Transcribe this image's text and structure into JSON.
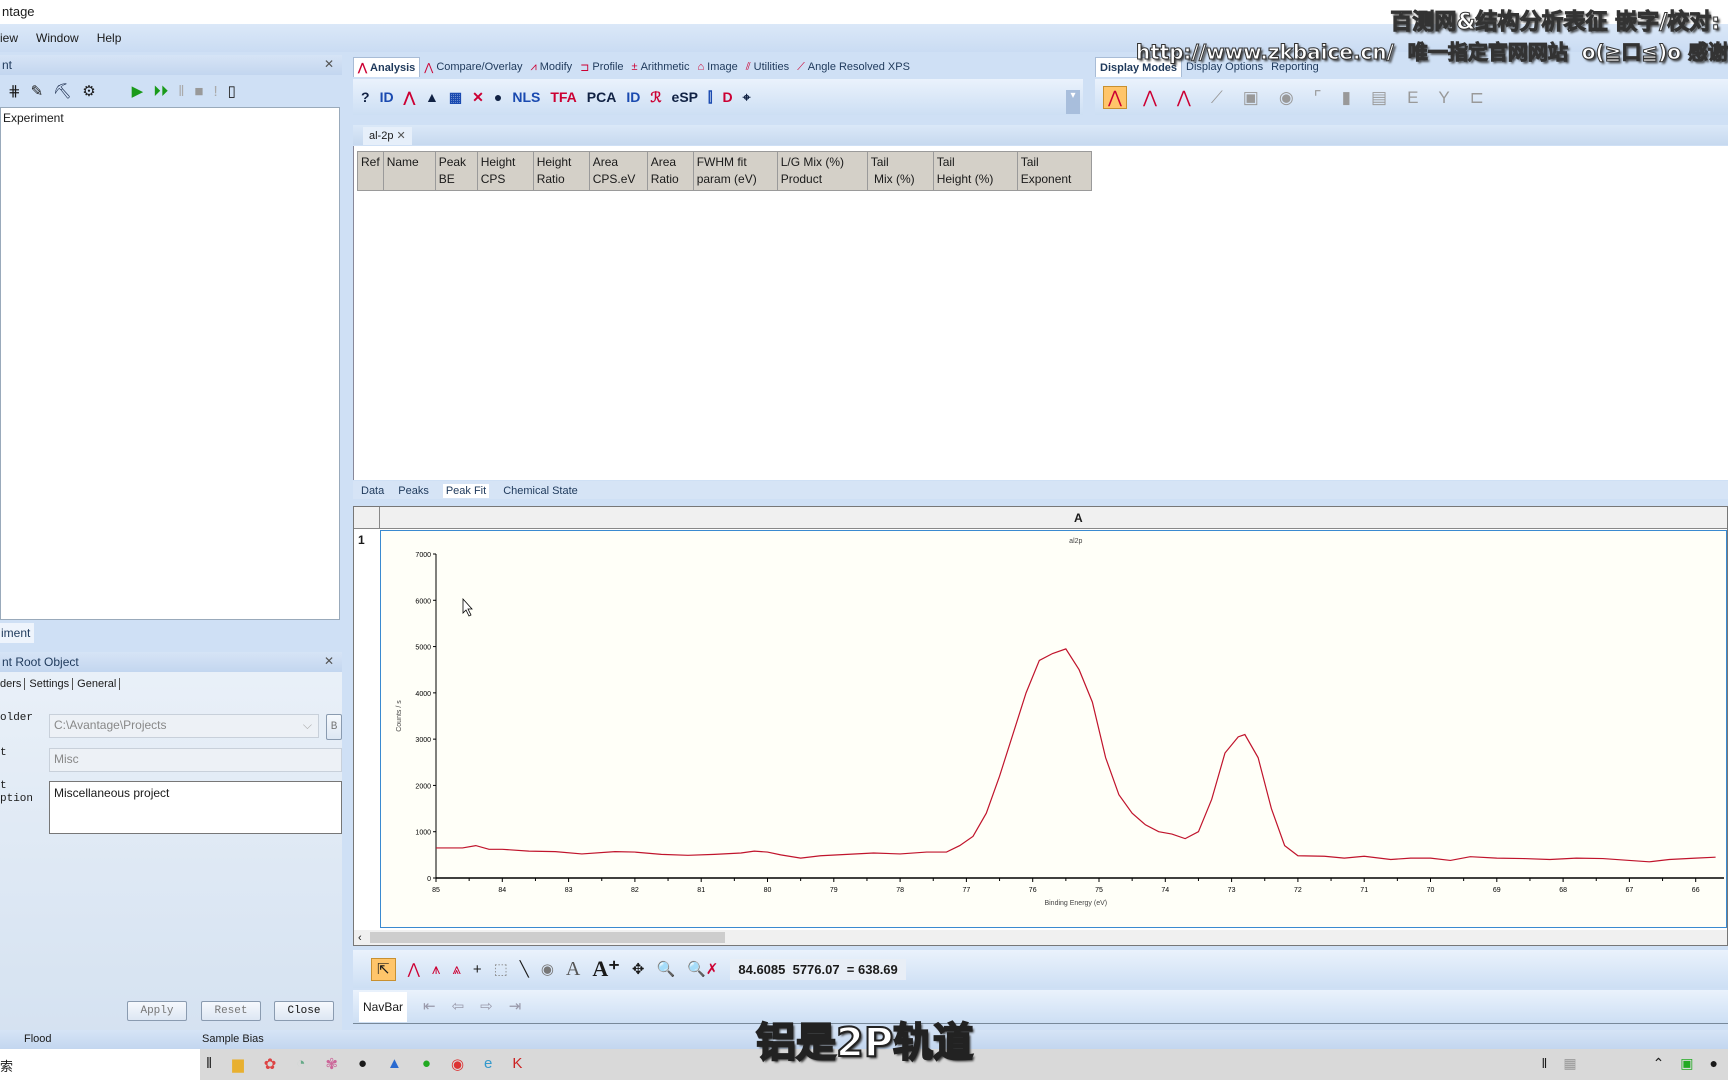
{
  "window": {
    "title": "ntage"
  },
  "menu": [
    "iew",
    "Window",
    "Help"
  ],
  "left_panel": {
    "title": "nt",
    "tree_item": "Experiment",
    "bottom_tab": "iment",
    "props_title": "nt Root Object",
    "tabs": [
      "ders",
      "Settings",
      "General"
    ],
    "fields": [
      {
        "label": "older",
        "value": "C:\\Avantage\\Projects",
        "button": "B"
      },
      {
        "label": "t",
        "value": "Misc"
      },
      {
        "label": "t\nption",
        "value": "Miscellaneous project"
      }
    ],
    "buttons": [
      "Apply",
      "Reset",
      "Close"
    ]
  },
  "ribbon": {
    "tabs": [
      "Analysis",
      "Compare/Overlay",
      "Modify",
      "Profile",
      "Arithmetic",
      "Image",
      "Utilities",
      "Angle Resolved XPS"
    ],
    "active_tab": "Analysis",
    "tools": [
      "?",
      "ID",
      "⋀",
      "▲",
      "▦",
      "✕",
      "●",
      "NLS",
      "TFA",
      "PCA",
      "ID",
      "ℛ",
      "eSP",
      "⫿",
      "D",
      "⌖"
    ],
    "right_tabs": [
      "Display Modes",
      "Display Options",
      "Reporting"
    ],
    "right_tools": [
      "⋀",
      "⋀",
      "⋀",
      "⟋",
      "▣",
      "◉",
      "⌜",
      "▮",
      "▤",
      "E",
      "Y",
      "⊏"
    ]
  },
  "document": {
    "tab": "al-2p",
    "columns": [
      "Ref",
      "Name",
      "Peak\nBE",
      "Height\nCPS",
      "Height\nRatio",
      "Area\nCPS.eV",
      "Area\nRatio",
      "FWHM fit\nparam (eV)",
      "L/G Mix (%)\nProduct",
      "Tail\n Mix (%)",
      "Tail\nHeight (%)",
      "Tail\nExponent"
    ],
    "bottom_tabs": [
      "Data",
      "Peaks",
      "Peak Fit",
      "Chemical State"
    ],
    "active_bottom_tab": "Peak Fit"
  },
  "chart_panel": {
    "column_label": "A",
    "row_label": "1"
  },
  "chart_data": {
    "type": "line",
    "title": "al2p",
    "xlabel": "Binding Energy (eV)",
    "ylabel": "Counts / s",
    "xlim": [
      85,
      65.7
    ],
    "ylim": [
      0,
      7000
    ],
    "xticks": [
      85,
      84,
      83,
      82,
      81,
      80,
      79,
      78,
      77,
      76,
      75,
      74,
      73,
      72,
      71,
      70,
      69,
      68,
      67,
      66
    ],
    "yticks": [
      0,
      1000,
      2000,
      3000,
      4000,
      5000,
      6000,
      7000
    ],
    "color": "#c0142c",
    "x": [
      85,
      84.6,
      84.4,
      84.2,
      84,
      83.6,
      83.2,
      82.8,
      82.3,
      82,
      81.6,
      81.2,
      80.8,
      80.4,
      80.2,
      80,
      79.8,
      79.5,
      79.2,
      78.8,
      78.4,
      78,
      77.6,
      77.3,
      77.1,
      76.9,
      76.7,
      76.5,
      76.3,
      76.1,
      75.9,
      75.7,
      75.5,
      75.3,
      75.1,
      74.9,
      74.7,
      74.5,
      74.3,
      74.1,
      73.9,
      73.7,
      73.5,
      73.3,
      73.1,
      72.9,
      72.8,
      72.6,
      72.4,
      72.2,
      72.0,
      71.6,
      71.3,
      71,
      70.6,
      70.3,
      70,
      69.7,
      69.4,
      69,
      68.6,
      68.2,
      67.8,
      67.4,
      67,
      66.7,
      66.4,
      66,
      65.7
    ],
    "y": [
      650,
      650,
      700,
      620,
      620,
      580,
      570,
      520,
      570,
      560,
      510,
      490,
      510,
      540,
      580,
      560,
      500,
      430,
      480,
      510,
      540,
      520,
      560,
      560,
      700,
      900,
      1400,
      2200,
      3100,
      4000,
      4700,
      4850,
      4950,
      4500,
      3800,
      2600,
      1800,
      1400,
      1150,
      1000,
      950,
      850,
      1000,
      1700,
      2700,
      3050,
      3100,
      2600,
      1500,
      700,
      480,
      470,
      430,
      470,
      400,
      430,
      430,
      380,
      460,
      430,
      420,
      400,
      430,
      420,
      380,
      350,
      400,
      430,
      450
    ]
  },
  "chart_toolbar": {
    "readout": "84.6085  5776.07  = 638.69",
    "navbar_label": "NavBar"
  },
  "status_bar": [
    "Flood",
    "Sample Bias"
  ],
  "taskbar": {
    "search": "索"
  },
  "overlay": {
    "watermark_line1": "百测网&结构分析表征 嵌字/校对:",
    "watermark_line2": "http://www.zkbaice.cn/  唯一指定官网网站  o(≧口≦)o 感谢",
    "subtitle": "铝是2P轨道"
  },
  "colors": {
    "accent": "#1e395b",
    "ribbon": "#cfe0f5",
    "spectrum": "#c0142c",
    "active_tool": "#ffc56a"
  }
}
